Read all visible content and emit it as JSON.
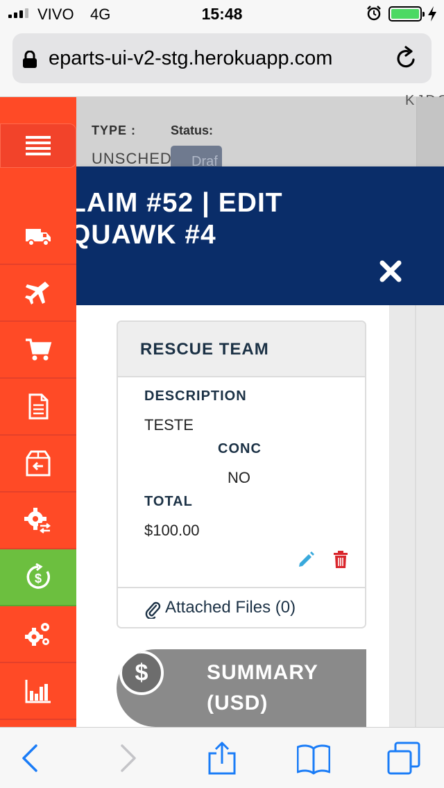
{
  "status_bar": {
    "carrier": "VIVO",
    "network": "4G",
    "time": "15:48",
    "icons": [
      "signal-icon",
      "alarm-icon",
      "battery-icon",
      "charging-icon"
    ]
  },
  "browser": {
    "url": "eparts-ui-v2-stg.herokuapp.com",
    "icons": [
      "lock-icon",
      "reload-icon"
    ]
  },
  "background_page": {
    "cut_text": "KJDQ",
    "type_label": "TYPE :",
    "status_label": "Status:",
    "type_value": "UNSCHED",
    "status_value": "Draf"
  },
  "modal": {
    "title": "LAIM #52 | EDIT\nQUAWK #4",
    "close_icon": "close-icon"
  },
  "card": {
    "title": "RESCUE TEAM",
    "description_label": "DESCRIPTION",
    "description_value": "TESTE",
    "conc_label": "CONC",
    "conc_value": "NO",
    "total_label": "TOTAL",
    "total_value": "$100.00",
    "attached_files": "Attached Files (0)",
    "accent_edit": "#39a9dc",
    "accent_delete": "#d9262c"
  },
  "summary": {
    "symbol": "$",
    "title": "SUMMARY\n(USD)"
  },
  "sidebar": {
    "items": [
      "menu-icon",
      "truck-icon",
      "airplane-icon",
      "cart-icon",
      "document-icon",
      "box-return-icon",
      "gear-exchange-icon",
      "refund-dollar-icon",
      "gears-icon",
      "bar-chart-icon"
    ],
    "active_item": "refund-dollar-icon",
    "color": "#ff4a26",
    "active_color": "#6cbf3f"
  },
  "toolbar": {
    "items": [
      "back-icon",
      "forward-icon",
      "share-icon",
      "bookmarks-icon",
      "tabs-icon"
    ]
  }
}
